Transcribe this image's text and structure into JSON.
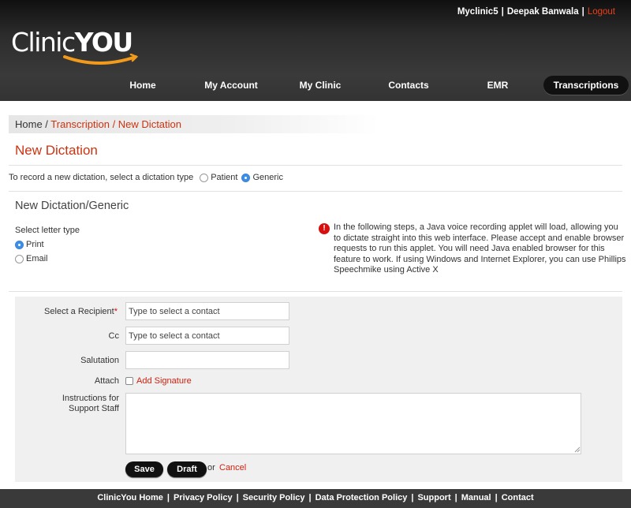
{
  "header": {
    "clinic": "Myclinic5",
    "user": "Deepak Banwala",
    "separator": "|",
    "logout": "Logout",
    "logo_light": "Clinic",
    "logo_bold": "YOU"
  },
  "nav": {
    "items": [
      {
        "label": "Home"
      },
      {
        "label": "My Account"
      },
      {
        "label": "My Clinic"
      },
      {
        "label": "Contacts"
      },
      {
        "label": "EMR"
      },
      {
        "label": "Transcriptions"
      }
    ],
    "active": "Transcriptions"
  },
  "breadcrumb": {
    "home": "Home",
    "sep1": " / ",
    "section": "Transcription",
    "sep2": " / ",
    "current": "New Dictation"
  },
  "page_title": "New Dictation",
  "dictation_type": {
    "prompt": "To record a new dictation, select a dictation type",
    "options": [
      "Patient",
      "Generic"
    ],
    "selected": "Generic"
  },
  "section_title": "New Dictation/Generic",
  "letter_type": {
    "label": "Select letter type",
    "options": [
      "Print",
      "Email"
    ],
    "selected": "Print"
  },
  "notice": {
    "icon": "!",
    "text": "In the following steps, a Java voice recording applet will load, allowing you to dictate straight into this web interface. Please accept and enable browser requests to run this applet. You will need Java enabled browser for this feature to work. If using Windows and Internet Explorer, you can use Phillips Speechmike using Active X"
  },
  "form": {
    "recipient_label": "Select a Recipient",
    "required_mark": "*",
    "recipient_placeholder": "Type to select a contact",
    "cc_label": "Cc",
    "cc_placeholder": "Type to select a contact",
    "salutation_label": "Salutation",
    "attach_label": "Attach",
    "add_signature": "Add Signature",
    "instructions_label_1": "Instructions for",
    "instructions_label_2": "Support Staff",
    "save": "Save",
    "draft": "Draft",
    "or": "or",
    "cancel": "Cancel"
  },
  "footer": {
    "links": [
      "ClinicYou Home",
      "Privacy Policy",
      "Security Policy",
      "Data Protection Policy",
      "Support",
      "Manual",
      "Contact"
    ],
    "separator": "|"
  },
  "colors": {
    "accent": "#cc3311",
    "header_bg": "#2c2c2c",
    "radio_checked": "#3d8ee6",
    "alert": "#d60f0f"
  }
}
